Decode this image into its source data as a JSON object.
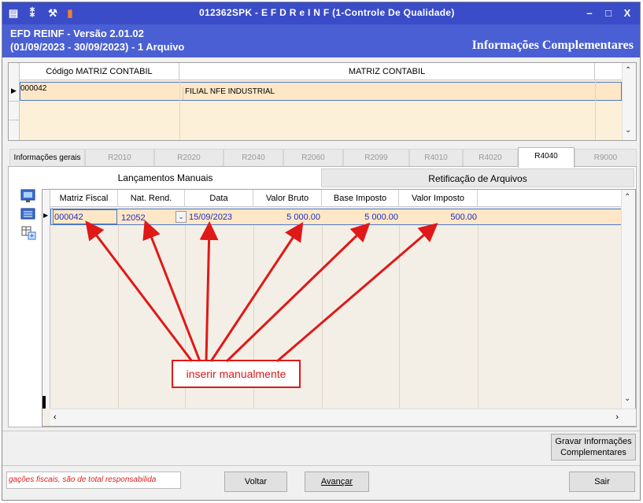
{
  "window": {
    "title": "012362SPK - E F D   R e I N F (1-Controle De Qualidade)",
    "app_version": "EFD REINF - Versão 2.01.02",
    "period": "(01/09/2023 - 30/09/2023) - 1 Arquivo",
    "section_title": "Informações Complementares",
    "minimize": "–",
    "maximize": "□",
    "close": "X"
  },
  "matriz_grid": {
    "columns": [
      "Código MATRIZ CONTABIL",
      "MATRIZ CONTABIL"
    ],
    "rows": [
      {
        "codigo": "000042",
        "matriz": "FILIAL NFE INDUSTRIAL"
      }
    ]
  },
  "tabs": [
    "Informações gerais",
    "R2010",
    "R2020",
    "R2040",
    "R2060",
    "R2099",
    "R4010",
    "R4020",
    "R4040",
    "R9000"
  ],
  "active_tab": "R4040",
  "subtabs": {
    "active": "Lançamentos Manuais",
    "other": "Retificação de Arquivos"
  },
  "lancamentos_grid": {
    "columns": [
      "Matriz Fiscal",
      "Nat. Rend.",
      "Data",
      "Valor Bruto",
      "Base Imposto",
      "Valor Imposto"
    ],
    "rows": [
      {
        "matriz_fiscal": "000042",
        "nat_rend": "12052",
        "data": "15/09/2023",
        "valor_bruto": "5 000.00",
        "base_imposto": "5 000.00",
        "valor_imposto": "500.00"
      }
    ]
  },
  "annotation": "inserir manualmente",
  "footer": {
    "note": "gações fiscais, são de total responsabilida",
    "voltar": "Voltar",
    "avancar": "Avançar",
    "sair": "Sair",
    "gravar_line1": "Gravar Informações",
    "gravar_line2": "Complementares"
  },
  "colors": {
    "titlebar": "#3a4cc7",
    "header": "#4a5fd3",
    "row_highlight": "#fde7c7",
    "cell_text": "#1e2fbf",
    "annotation": "#e01818"
  }
}
